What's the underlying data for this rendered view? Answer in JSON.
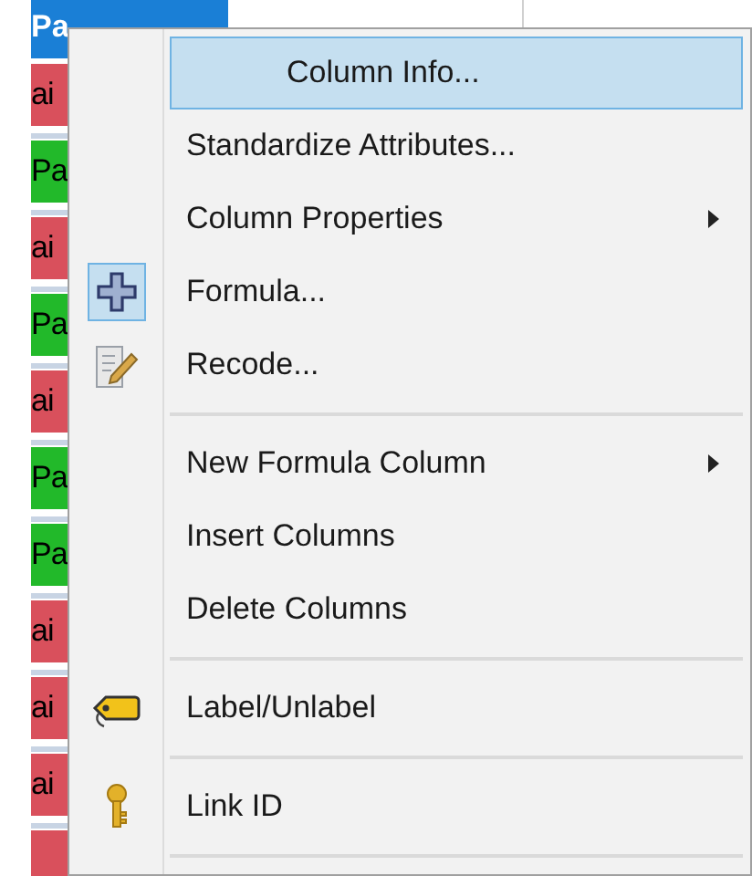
{
  "table": {
    "columns": [
      {
        "label": "Pa",
        "selected": true
      },
      {
        "selected": false
      }
    ],
    "rows": [
      {
        "cell": "ai",
        "color": "#d9505c"
      },
      {
        "cell": "Pa",
        "color": "#22b92a"
      },
      {
        "cell": "ai",
        "color": "#d9505c"
      },
      {
        "cell": "Pa",
        "color": "#22b92a"
      },
      {
        "cell": "ai",
        "color": "#d9505c"
      },
      {
        "cell": "Pa",
        "color": "#22b92a"
      },
      {
        "cell": "Pa",
        "color": "#22b92a"
      },
      {
        "cell": "ai",
        "color": "#d9505c"
      },
      {
        "cell": "ai",
        "color": "#d9505c"
      },
      {
        "cell": "ai",
        "color": "#d9505c"
      },
      {
        "cell": "",
        "color": "#d9505c"
      }
    ]
  },
  "context_menu": {
    "items": [
      {
        "kind": "command",
        "label": "Column Info...",
        "selected": true,
        "checked": false
      },
      {
        "kind": "command",
        "label": "Standardize Attributes...",
        "selected": false,
        "checked": false
      },
      {
        "kind": "submenu",
        "label": "Column Properties",
        "selected": false,
        "checked": false
      },
      {
        "kind": "command",
        "label": "Formula...",
        "selected": false,
        "checked": true
      },
      {
        "kind": "command",
        "label": "Recode...",
        "selected": false,
        "checked": false
      },
      {
        "kind": "separator"
      },
      {
        "kind": "submenu",
        "label": "New Formula Column",
        "selected": false,
        "checked": false
      },
      {
        "kind": "command",
        "label": "Insert Columns",
        "selected": false,
        "checked": false
      },
      {
        "kind": "command",
        "label": "Delete Columns",
        "selected": false,
        "checked": false
      },
      {
        "kind": "separator"
      },
      {
        "kind": "command",
        "label": "Label/Unlabel",
        "selected": false,
        "checked": false
      },
      {
        "kind": "separator"
      },
      {
        "kind": "command",
        "label": "Link ID",
        "selected": false,
        "checked": false
      },
      {
        "kind": "separator"
      }
    ]
  }
}
